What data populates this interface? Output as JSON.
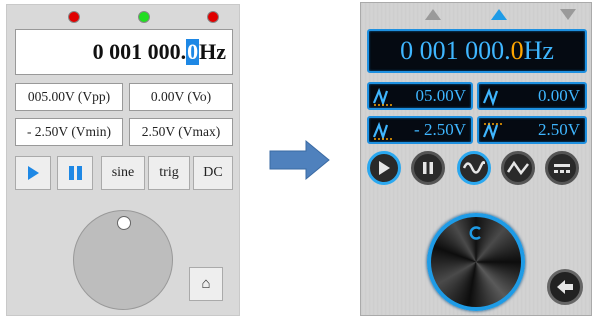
{
  "left_panel": {
    "leds": [
      "red",
      "green",
      "red"
    ],
    "frequency": {
      "prefix": "0 001 000.",
      "cursor_digit": "0",
      "unit": "Hz"
    },
    "fields": {
      "vpp": "005.00V (Vpp)",
      "vo": "0.00V (Vo)",
      "vmin": "- 2.50V (Vmin)",
      "vmax": "2.50V (Vmax)"
    },
    "buttons": {
      "sine": "sine",
      "trig": "trig",
      "dc": "DC"
    },
    "icons": [
      "play-icon",
      "pause-icon",
      "home-icon"
    ]
  },
  "right_panel": {
    "frequency": {
      "prefix": "0 001 000.",
      "cursor_digit": "0",
      "unit": "Hz"
    },
    "fields": {
      "vpp": "05.00V",
      "vo": "0.00V",
      "vmin": "- 2.50V",
      "vmax": "2.50V"
    },
    "icons": [
      "play-icon",
      "pause-icon",
      "sine-wave-icon",
      "triangle-wave-icon",
      "dc-icon",
      "back-icon"
    ]
  },
  "colors": {
    "accent": "#1e88e5",
    "led_red": "#e00000",
    "led_green": "#22dd22",
    "lcd_text": "#3fb6ff",
    "lcd_cursor": "#ffa500",
    "arrow": "#4f81bd"
  }
}
